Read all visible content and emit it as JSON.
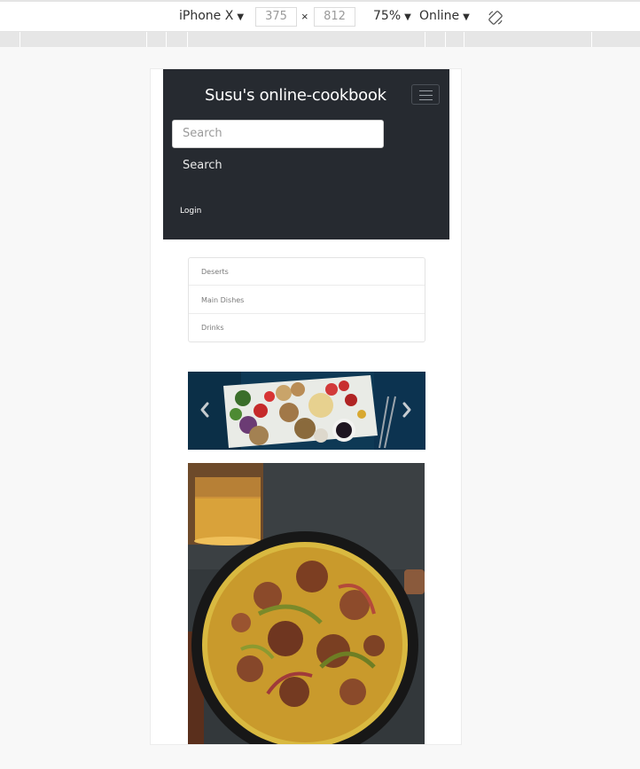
{
  "devtools": {
    "device": "iPhone X",
    "width": "375",
    "height": "812",
    "zoom": "75%",
    "network": "Online"
  },
  "navbar": {
    "brand": "Susu's online-cookbook",
    "search_placeholder": "Search",
    "search_button": "Search",
    "login": "Login"
  },
  "categories": [
    "Deserts",
    "Main Dishes",
    "Drinks"
  ],
  "colors": {
    "navbar_bg": "#262a30",
    "page_bg": "#ffffff",
    "carousel_bg": "#0f3a56"
  }
}
